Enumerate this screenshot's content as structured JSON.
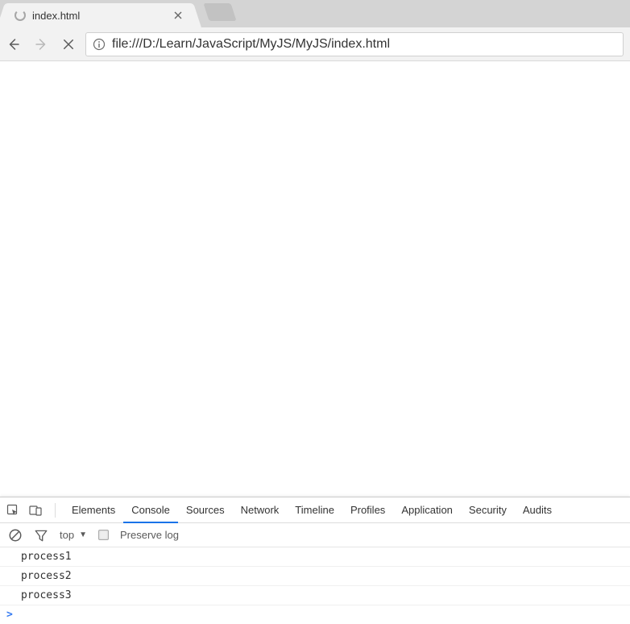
{
  "tab": {
    "title": "index.html"
  },
  "address": {
    "url": "file:///D:/Learn/JavaScript/MyJS/MyJS/index.html"
  },
  "devtools": {
    "tabs": [
      "Elements",
      "Console",
      "Sources",
      "Network",
      "Timeline",
      "Profiles",
      "Application",
      "Security",
      "Audits"
    ],
    "active_tab_index": 1,
    "context_label": "top",
    "preserve_log_label": "Preserve log",
    "console_rows": [
      "process1",
      "process2",
      "process3"
    ],
    "prompt": ">"
  }
}
